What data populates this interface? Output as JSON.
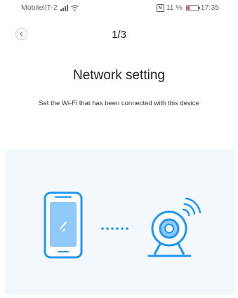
{
  "status_bar": {
    "carrier": "Mobitel|T-2",
    "battery_percent": "11 %",
    "time": "17:35"
  },
  "header": {
    "back_icon": "chevron-left-icon",
    "step": "1/3"
  },
  "content": {
    "title": "Network setting",
    "subtitle": "Set the Wi-Fi that has been connected with this device"
  },
  "illustration": {
    "phone_icon": "smartphone-icon",
    "camera_icon": "camera-wifi-icon",
    "accent_color": "#2196f3",
    "screen_color": "#8ec9f7",
    "background_color": "#f3f8fd"
  }
}
